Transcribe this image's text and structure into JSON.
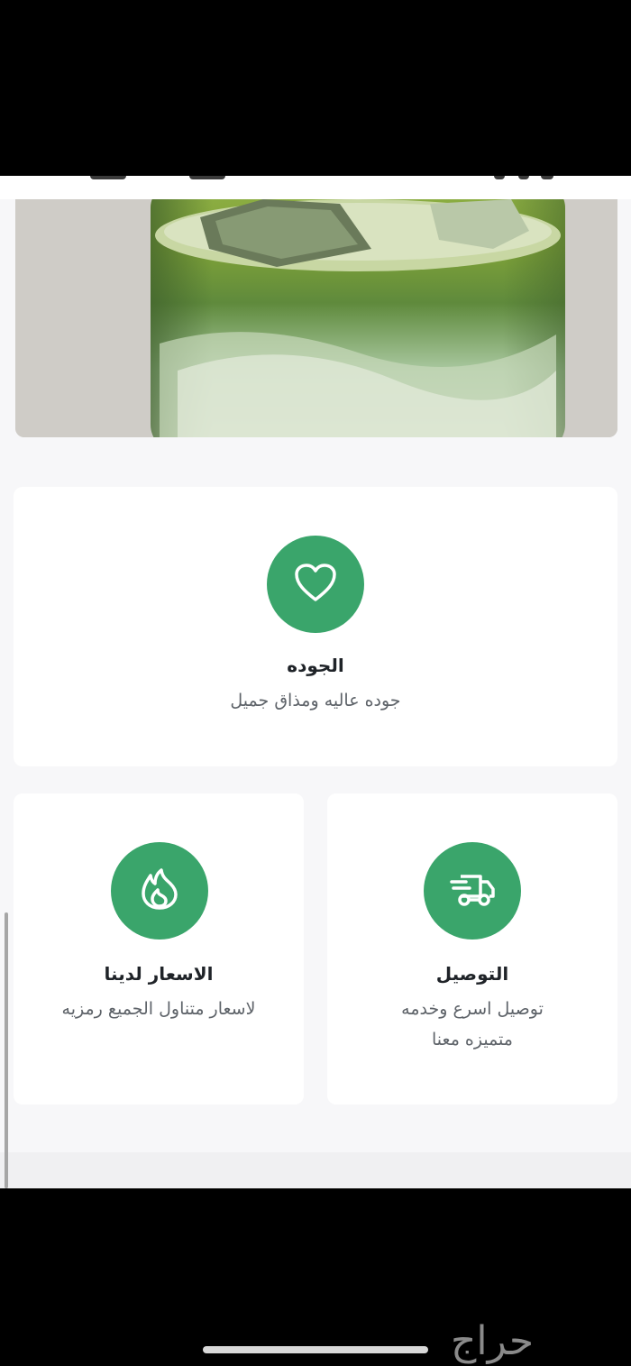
{
  "features": {
    "quality": {
      "title": "الجوده",
      "description": "جوده عاليه ومذاق جميل",
      "icon": "heart-icon"
    },
    "prices": {
      "title": "الاسعار لدينا",
      "description": "لاسعار متناول الجميع رمزيه",
      "icon": "fire-icon"
    },
    "delivery": {
      "title": "التوصيل",
      "description_line1": "توصيل اسرع وخدمه",
      "description_line2": "متميزه معنا",
      "icon": "delivery-truck-icon"
    }
  },
  "colors": {
    "accent": "#3aa56b",
    "card_background": "#ffffff",
    "page_background": "#f7f7f9"
  },
  "watermark": "حراج"
}
